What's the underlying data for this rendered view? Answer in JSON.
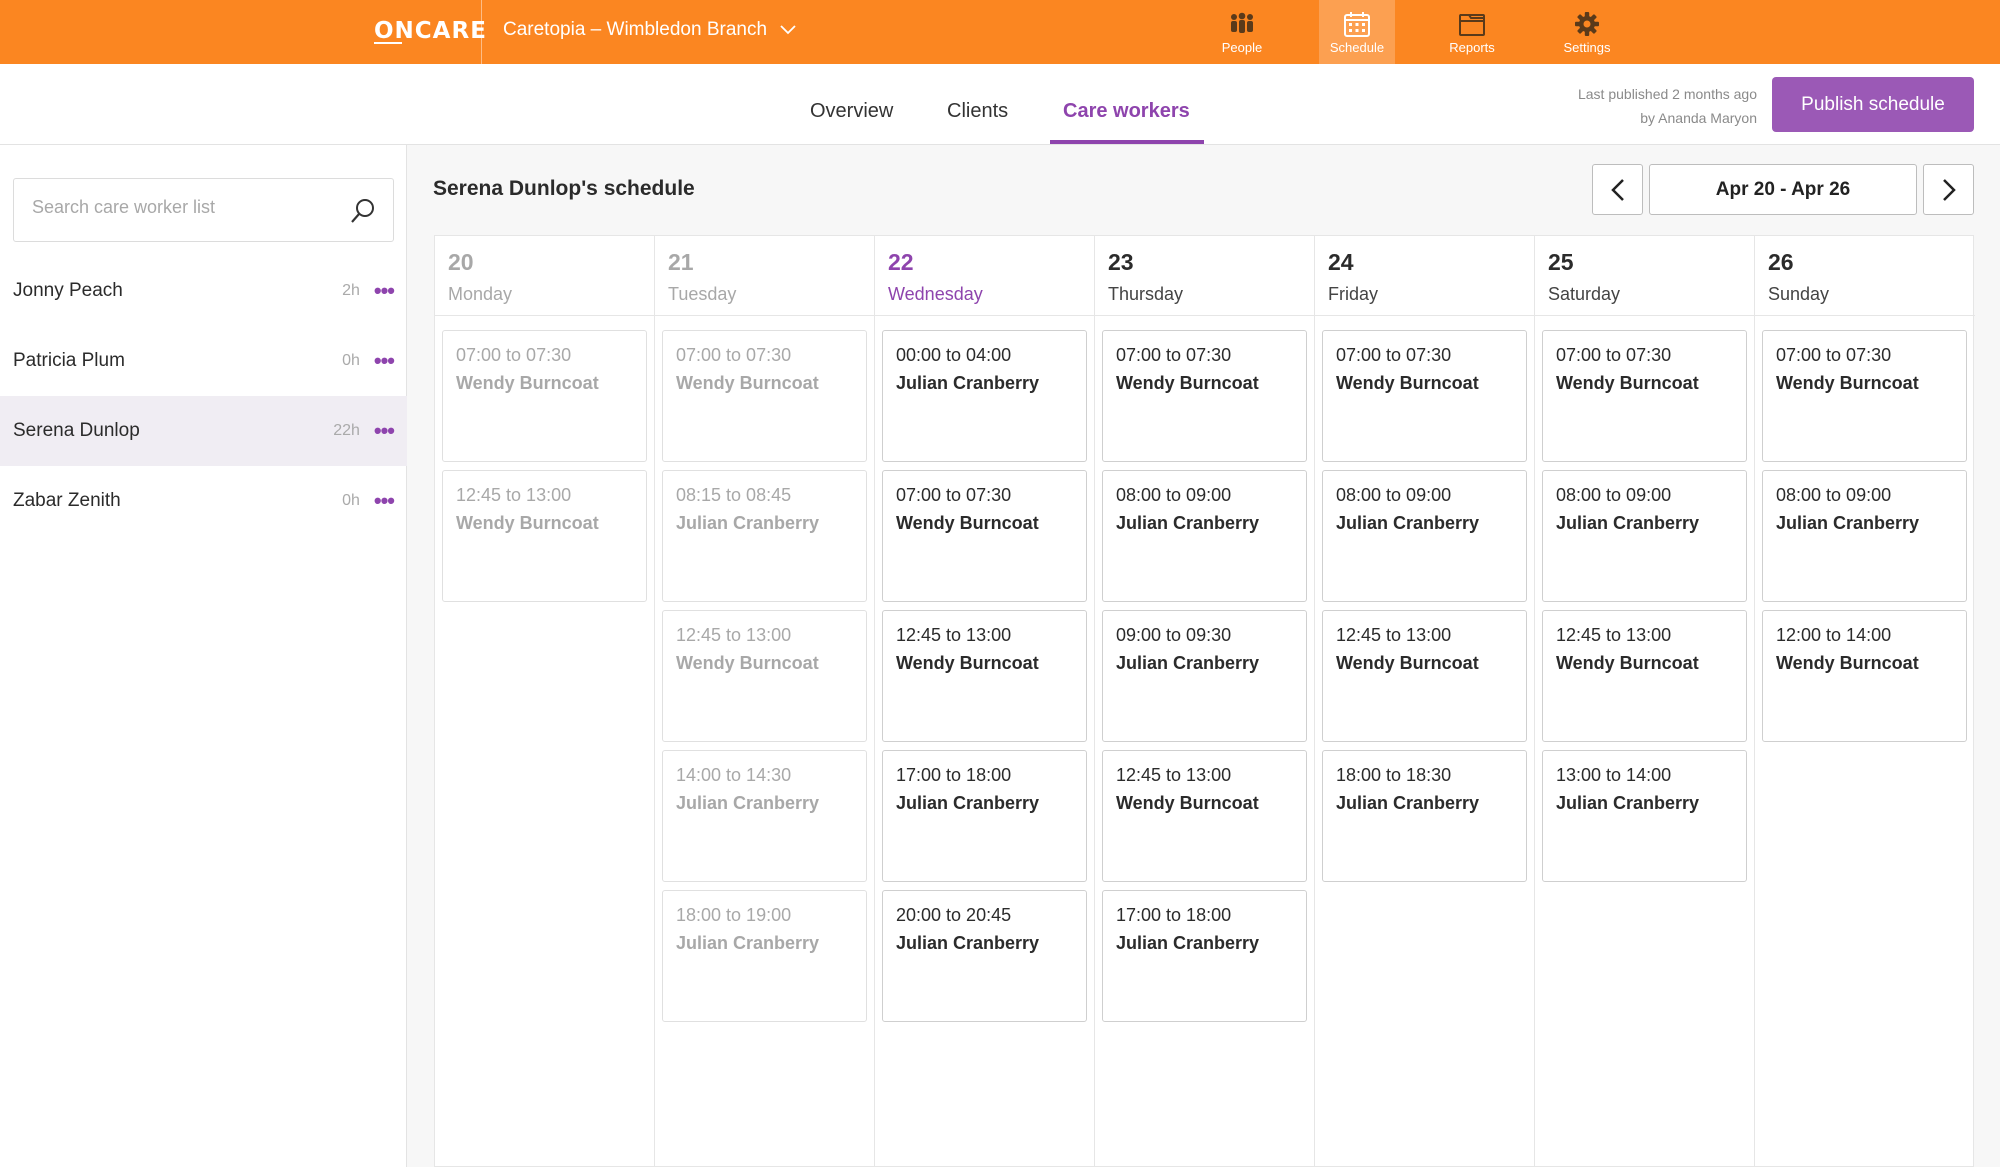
{
  "app": {
    "logo_text": "ONCARE",
    "branch": "Caretopia – Wimbledon Branch",
    "nav": [
      {
        "label": "People",
        "icon": "people-icon"
      },
      {
        "label": "Schedule",
        "icon": "calendar-icon",
        "active": true
      },
      {
        "label": "Reports",
        "icon": "folder-icon"
      },
      {
        "label": "Settings",
        "icon": "gear-icon"
      }
    ],
    "accent_color": "#fb8621",
    "brand_purple": "#8e44ad"
  },
  "tabs": [
    {
      "label": "Overview"
    },
    {
      "label": "Clients"
    },
    {
      "label": "Care workers",
      "active": true
    }
  ],
  "publish": {
    "info_line1": "Last published 2 months ago",
    "info_line2": "by Ananda Maryon",
    "button_label": "Publish schedule"
  },
  "sidebar": {
    "search_placeholder": "Search care worker list",
    "workers": [
      {
        "name": "Jonny Peach",
        "hours": "2h",
        "menu": "•••"
      },
      {
        "name": "Patricia Plum",
        "hours": "0h",
        "menu": "•••"
      },
      {
        "name": "Serena Dunlop",
        "hours": "22h",
        "menu": "•••",
        "selected": true
      },
      {
        "name": "Zabar Zenith",
        "hours": "0h",
        "menu": "•••"
      }
    ]
  },
  "schedule": {
    "title": "Serena Dunlop's schedule",
    "range": "Apr 20 - Apr 26",
    "days": [
      {
        "num": "20",
        "name": "Monday",
        "state": "past",
        "visits": [
          {
            "time": "07:00 to 07:30",
            "client": "Wendy Burncoat"
          },
          {
            "time": "12:45 to 13:00",
            "client": "Wendy Burncoat"
          }
        ]
      },
      {
        "num": "21",
        "name": "Tuesday",
        "state": "past",
        "visits": [
          {
            "time": "07:00 to 07:30",
            "client": "Wendy Burncoat"
          },
          {
            "time": "08:15 to 08:45",
            "client": "Julian Cranberry"
          },
          {
            "time": "12:45 to 13:00",
            "client": "Wendy Burncoat"
          },
          {
            "time": "14:00 to 14:30",
            "client": "Julian Cranberry"
          },
          {
            "time": "18:00 to 19:00",
            "client": "Julian Cranberry"
          }
        ]
      },
      {
        "num": "22",
        "name": "Wednesday",
        "state": "today",
        "visits": [
          {
            "time": "00:00 to 04:00",
            "client": "Julian Cranberry"
          },
          {
            "time": "07:00 to 07:30",
            "client": "Wendy Burncoat"
          },
          {
            "time": "12:45 to 13:00",
            "client": "Wendy Burncoat"
          },
          {
            "time": "17:00 to 18:00",
            "client": "Julian Cranberry"
          },
          {
            "time": "20:00 to 20:45",
            "client": "Julian Cranberry"
          }
        ]
      },
      {
        "num": "23",
        "name": "Thursday",
        "state": "future",
        "visits": [
          {
            "time": "07:00 to 07:30",
            "client": "Wendy Burncoat"
          },
          {
            "time": "08:00 to 09:00",
            "client": "Julian Cranberry"
          },
          {
            "time": "09:00 to 09:30",
            "client": "Julian Cranberry"
          },
          {
            "time": "12:45 to 13:00",
            "client": "Wendy Burncoat"
          },
          {
            "time": "17:00 to 18:00",
            "client": "Julian Cranberry"
          }
        ]
      },
      {
        "num": "24",
        "name": "Friday",
        "state": "future",
        "visits": [
          {
            "time": "07:00 to 07:30",
            "client": "Wendy Burncoat"
          },
          {
            "time": "08:00 to 09:00",
            "client": "Julian Cranberry"
          },
          {
            "time": "12:45 to 13:00",
            "client": "Wendy Burncoat"
          },
          {
            "time": "18:00 to 18:30",
            "client": "Julian Cranberry"
          }
        ]
      },
      {
        "num": "25",
        "name": "Saturday",
        "state": "future",
        "visits": [
          {
            "time": "07:00 to 07:30",
            "client": "Wendy Burncoat"
          },
          {
            "time": "08:00 to 09:00",
            "client": "Julian Cranberry"
          },
          {
            "time": "12:45 to 13:00",
            "client": "Wendy Burncoat"
          },
          {
            "time": "13:00 to 14:00",
            "client": "Julian Cranberry"
          }
        ]
      },
      {
        "num": "26",
        "name": "Sunday",
        "state": "future",
        "visits": [
          {
            "time": "07:00 to 07:30",
            "client": "Wendy Burncoat"
          },
          {
            "time": "08:00 to 09:00",
            "client": "Julian Cranberry"
          },
          {
            "time": "12:00 to 14:00",
            "client": "Wendy Burncoat"
          }
        ]
      }
    ]
  }
}
